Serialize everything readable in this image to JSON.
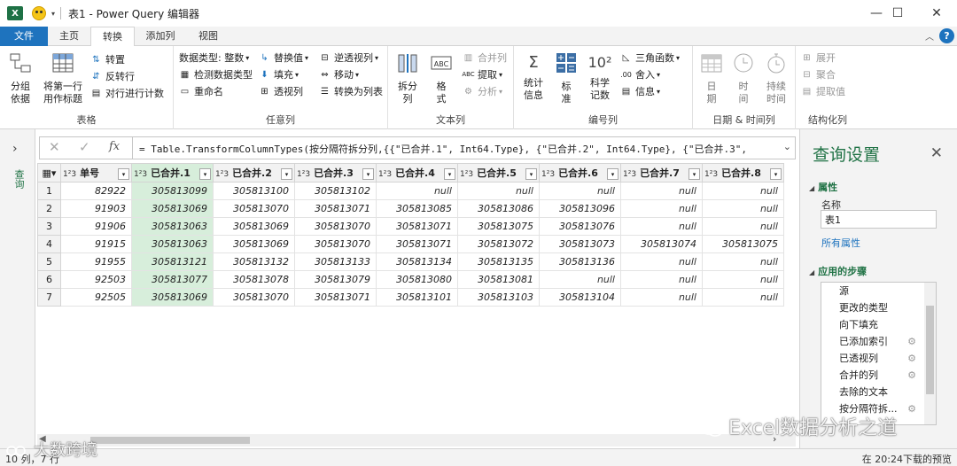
{
  "window": {
    "title": "表1 - Power Query 编辑器",
    "excel_logo": "X",
    "controls": [
      "—",
      "☐",
      "✕"
    ]
  },
  "ribbon_tabs": [
    "文件",
    "主页",
    "转换",
    "添加列",
    "视图"
  ],
  "active_tab": "转换",
  "help": "?",
  "ribbon": {
    "table_group": {
      "label": "表格",
      "group_by": "分组\n依据",
      "use_first_row": "将第一行\n用作标题",
      "transpose": "转置",
      "reverse_rows": "反转行",
      "count_rows": "对行进行计数"
    },
    "any_column_group": {
      "label": "任意列",
      "data_type": "数据类型: 整数",
      "detect_type": "检测数据类型",
      "rename": "重命名",
      "replace_values": "替换值",
      "fill": "填充",
      "pivot": "透视列",
      "unpivot": "逆透视列",
      "move": "移动",
      "to_list": "转换为列表"
    },
    "text_column_group": {
      "label": "文本列",
      "split": "拆分\n列",
      "format": "格\n式",
      "merge": "合并列",
      "extract": "提取",
      "parse": "分析"
    },
    "number_column_group": {
      "label": "编号列",
      "statistics": "统计\n信息",
      "standard": "标\n准",
      "scientific": "科学\n记数",
      "trig": "三角函数",
      "rounding": "舍入",
      "info": "信息"
    },
    "datetime_group": {
      "label": "日期 & 时间列",
      "date": "日\n期",
      "time": "时\n间",
      "duration": "持续\n时间"
    },
    "structured_group": {
      "label": "结构化列",
      "expand": "展开",
      "aggregate": "聚合",
      "extract_values": "提取值"
    }
  },
  "left_nav": {
    "label": "查询"
  },
  "formula": "= Table.TransformColumnTypes(按分隔符拆分列,{{\"已合并.1\", Int64.Type}, {\"已合并.2\", Int64.Type}, {\"已合并.3\",",
  "columns": [
    "单号",
    "已合并.1",
    "已合并.2",
    "已合并.3",
    "已合并.4",
    "已合并.5",
    "已合并.6",
    "已合并.7",
    "已合并.8"
  ],
  "column_type_label": "1²3",
  "rows": [
    [
      "1",
      "82922",
      "305813099",
      "305813100",
      "305813102",
      "null",
      "null",
      "null",
      "null",
      "null"
    ],
    [
      "2",
      "91903",
      "305813069",
      "305813070",
      "305813071",
      "305813085",
      "305813086",
      "305813096",
      "null",
      "null"
    ],
    [
      "3",
      "91906",
      "305813063",
      "305813069",
      "305813070",
      "305813071",
      "305813075",
      "305813076",
      "null",
      "null"
    ],
    [
      "4",
      "91915",
      "305813063",
      "305813069",
      "305813070",
      "305813071",
      "305813072",
      "305813073",
      "305813074",
      "305813075"
    ],
    [
      "5",
      "91955",
      "305813121",
      "305813132",
      "305813133",
      "305813134",
      "305813135",
      "305813136",
      "null",
      "null"
    ],
    [
      "6",
      "92503",
      "305813077",
      "305813078",
      "305813079",
      "305813080",
      "305813081",
      "null",
      "null",
      "null"
    ],
    [
      "7",
      "92505",
      "305813069",
      "305813070",
      "305813071",
      "305813101",
      "305813103",
      "305813104",
      "null",
      "null"
    ]
  ],
  "settings": {
    "title": "查询设置",
    "properties_header": "属性",
    "name_label": "名称",
    "name_value": "表1",
    "all_properties": "所有属性",
    "steps_header": "应用的步骤",
    "steps": [
      {
        "label": "源",
        "gear": false
      },
      {
        "label": "更改的类型",
        "gear": false
      },
      {
        "label": "向下填充",
        "gear": false
      },
      {
        "label": "已添加索引",
        "gear": true
      },
      {
        "label": "已透视列",
        "gear": true
      },
      {
        "label": "合并的列",
        "gear": true
      },
      {
        "label": "去除的文本",
        "gear": false
      },
      {
        "label": "按分隔符拆...",
        "gear": true
      }
    ]
  },
  "status": {
    "left": "10 列，7 行",
    "right": "在 20:24下载的预览"
  },
  "watermarks": {
    "right": "Excel数据分析之道",
    "left": "大数跨境"
  },
  "colors": {
    "accent_green": "#217346",
    "file_tab_blue": "#1e73be",
    "selected_column": "#d7eedb"
  }
}
